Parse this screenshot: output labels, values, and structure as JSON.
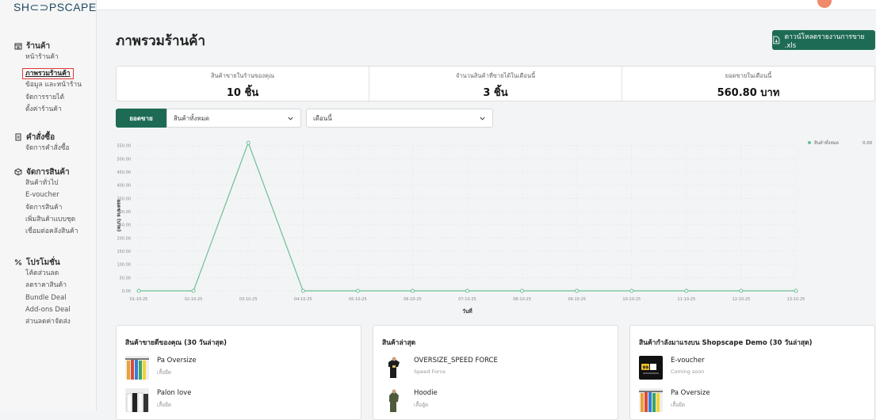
{
  "brand": {
    "logo": "SH⊂⊃PSCAPE"
  },
  "sidebar": {
    "sections": [
      {
        "title": "ร้านค้า",
        "items": [
          "หน้าร้านค้า",
          "ภาพรวมร้านค้า",
          "ข้อมูล และหน้าร้าน",
          "จัดการรายได้",
          "ตั้งค่าร้านค้า"
        ]
      },
      {
        "title": "คำสั่งซื้อ",
        "items": [
          "จัดการคำสั่งซื้อ"
        ]
      },
      {
        "title": "จัดการสินค้า",
        "items": [
          "สินค้าทั่วไป",
          "E-voucher",
          "จัดการสินค้า",
          "เพิ่มสินค้าแบบชุด",
          "เชื่อมต่อคลังสินค้า"
        ]
      },
      {
        "title": "โปรโมชั่น",
        "items": [
          "โค้ดส่วนลด",
          "ลดราคาสินค้า",
          "Bundle Deal",
          "Add-ons Deal",
          "ส่วนลดค่าจัดส่ง"
        ]
      }
    ],
    "active_item": "ภาพรวมร้านค้า"
  },
  "header": {
    "title": "ภาพรวมร้านค้า",
    "download_label": "ดาวน์โหลดรายงานการขาย .xls"
  },
  "stats": [
    {
      "label": "สินค้าขายในร้านของคุณ",
      "value": "10 ชิ้น"
    },
    {
      "label": "จำนวนสินค้าที่ขายได้ในเดือนนี้",
      "value": "3 ชิ้น"
    },
    {
      "label": "ยอดขายในเดือนนี้",
      "value": "560.80 บาท"
    }
  ],
  "filters": {
    "sales_label": "ยอดขาย",
    "product_select": "สินค้าทั้งหมด",
    "period_select": "เดือนนี้"
  },
  "chart_data": {
    "type": "line",
    "x": [
      "01-10-25",
      "02-10-25",
      "03-10-25",
      "04-10-25",
      "05-10-25",
      "06-10-25",
      "07-10-25",
      "08-10-25",
      "09-10-25",
      "10-10-25",
      "11-10-25",
      "12-10-25",
      "13-10-25"
    ],
    "series": [
      {
        "name": "สินค้าทั้งหมด",
        "values": [
          0,
          0,
          560.8,
          0,
          0,
          0,
          0,
          0,
          0,
          0,
          0,
          0,
          0
        ],
        "color": "#6dbf98"
      }
    ],
    "yticks": [
      "0.00",
      "50.00",
      "100.00",
      "150.00",
      "200.00",
      "250.00",
      "300.00",
      "350.00",
      "400.00",
      "450.00",
      "500.00",
      "550.00"
    ],
    "ylim": [
      0,
      560
    ],
    "xlabel": "วันที่",
    "ylabel": "ยอดขาย (บาท)",
    "legend_value": "0.00",
    "legend_position": "top-right",
    "grid": true
  },
  "cards": [
    {
      "title": "สินค้าขายดีของคุณ (30 วันล่าสุด)",
      "items": [
        {
          "name": "Pa Oversize",
          "sub": "เสื้อยืด",
          "thumb": "rainbow-shirts"
        },
        {
          "name": "Palon love",
          "sub": "เสื้อยืด",
          "thumb": "bw-shirts"
        }
      ]
    },
    {
      "title": "สินค้าล่าสุด",
      "items": [
        {
          "name": "OVERSIZE_SPEED FORCE",
          "sub": "Speed Force",
          "thumb": "black-tee"
        },
        {
          "name": "Hoodie",
          "sub": "เสื้อฮู้ด",
          "thumb": "green-hoodie"
        }
      ]
    },
    {
      "title": "สินค้ากำลังมาแรงบน Shopscape Demo (30 วันล่าสุด)",
      "items": [
        {
          "name": "E-voucher",
          "sub": "Coming soon",
          "thumb": "voucher"
        },
        {
          "name": "Pa Oversize",
          "sub": "เสื้อยืด",
          "thumb": "rainbow-shirts"
        }
      ]
    }
  ],
  "colors": {
    "primary": "#1e6b55",
    "line": "#6dbf98",
    "active_outline": "#e03a3a"
  },
  "icons": [
    "store-icon",
    "order-icon",
    "product-icon",
    "promotion-icon",
    "download-icon",
    "chevron-down-icon"
  ]
}
